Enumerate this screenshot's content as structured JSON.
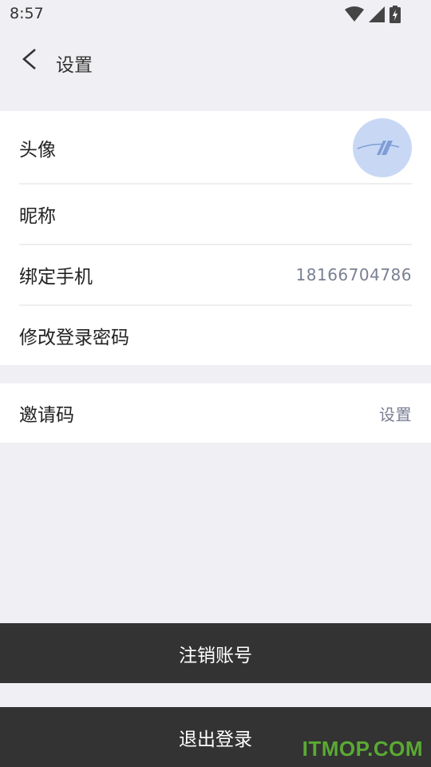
{
  "status_bar": {
    "time": "8:57",
    "icons": [
      "wifi-icon",
      "signal-icon",
      "battery-icon"
    ]
  },
  "header": {
    "title": "设置",
    "back_icon": "chevron-left-icon"
  },
  "settings_group_1": {
    "avatar_label": "头像",
    "nickname_label": "昵称",
    "phone_label": "绑定手机",
    "phone_value": "18166704786",
    "password_label": "修改登录密码"
  },
  "settings_group_2": {
    "invite_label": "邀请码",
    "invite_value": "设置"
  },
  "buttons": {
    "cancel_account": "注销账号",
    "logout": "退出登录"
  },
  "watermark": "ITMOP.COM",
  "colors": {
    "background": "#f0f0f4",
    "button": "#333333",
    "avatar_bg": "#c8d8f4",
    "value_text": "#7a7f93",
    "watermark": "#5aaa32"
  }
}
